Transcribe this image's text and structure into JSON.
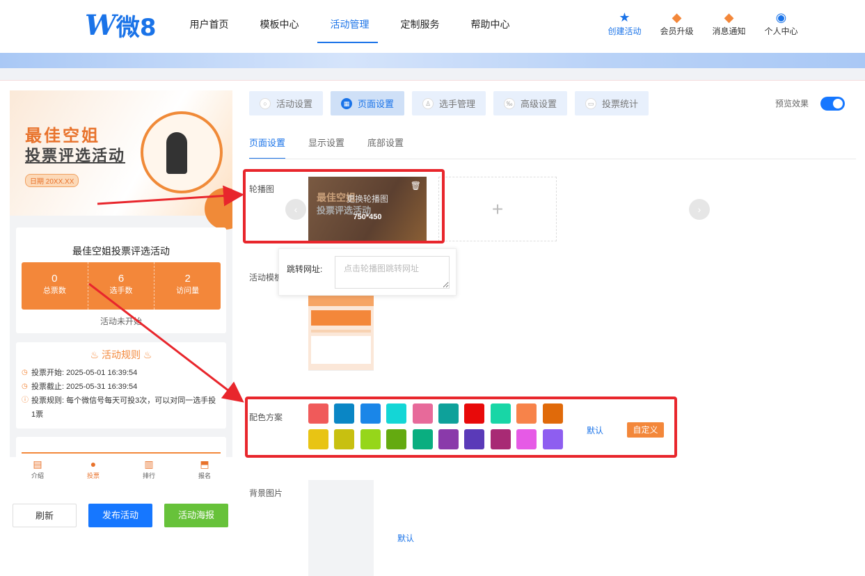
{
  "logo": {
    "mark": "W",
    "text": "微8"
  },
  "nav": [
    "用户首页",
    "模板中心",
    "活动管理",
    "定制服务",
    "帮助中心"
  ],
  "top_icons": [
    {
      "icon": "star-icon",
      "glyph": "★",
      "label": "创建活动"
    },
    {
      "icon": "diamond-icon",
      "glyph": "◆",
      "label": "会员升级"
    },
    {
      "icon": "bell-icon",
      "glyph": "◆",
      "label": "消息通知"
    },
    {
      "icon": "user-icon",
      "glyph": "◉",
      "label": "个人中心"
    }
  ],
  "poster": {
    "line1": "最佳空姐",
    "line2": "投票评选活动",
    "date": "日期 20XX.XX"
  },
  "activity": {
    "title": "最佳空姐投票评选活动",
    "stats": [
      {
        "value": "0",
        "label": "总票数"
      },
      {
        "value": "6",
        "label": "选手数"
      },
      {
        "value": "2",
        "label": "访问量"
      }
    ],
    "status": "活动未开始"
  },
  "rules": {
    "title": "活动规则",
    "items": [
      {
        "label": "投票开始:",
        "value": "2025-05-01 16:39:54"
      },
      {
        "label": "投票截止:",
        "value": "2025-05-31 16:39:54"
      },
      {
        "label": "投票规则:",
        "value": "每个微信号每天可投3次，可以对同一选手投1票"
      }
    ]
  },
  "bottom_tabs": [
    {
      "icon": "intro-icon",
      "glyph": "▤",
      "label": "介绍"
    },
    {
      "icon": "vote-icon",
      "glyph": "●",
      "label": "投票"
    },
    {
      "icon": "rank-icon",
      "glyph": "▥",
      "label": "排行"
    },
    {
      "icon": "signup-icon",
      "glyph": "⬒",
      "label": "报名"
    }
  ],
  "buttons": {
    "refresh": "刷新",
    "publish": "发布活动",
    "poster": "活动海报"
  },
  "tabs": [
    {
      "icon": "settings-icon",
      "label": "活动设置"
    },
    {
      "icon": "page-icon",
      "label": "页面设置"
    },
    {
      "icon": "player-icon",
      "label": "选手管理"
    },
    {
      "icon": "advanced-icon",
      "label": "高级设置"
    },
    {
      "icon": "stats-icon",
      "label": "投票统计"
    }
  ],
  "preview_label": "预览效果",
  "subtabs": [
    "页面设置",
    "显示设置",
    "底部设置"
  ],
  "carousel": {
    "label": "轮播图",
    "overlay": "更换轮播图",
    "size": "750*450",
    "link_label": "跳转网址:",
    "link_placeholder": "点击轮播图跳转网址"
  },
  "template_label": "活动模板",
  "color_scheme": {
    "label": "配色方案",
    "colors": [
      "#f05a5a",
      "#0a86c5",
      "#1a86e8",
      "#14d6d6",
      "#e76a9a",
      "#0ea19a",
      "#e80a0a",
      "#18d6a6",
      "#f7834a",
      "#e06a0a",
      "#e8c414",
      "#c8c010",
      "#96d61a",
      "#64aa10",
      "#0aae80",
      "#8a3aaa",
      "#5a3ab8",
      "#a82a74",
      "#e65ae6",
      "#8e5ef0"
    ],
    "default": "默认",
    "custom": "自定义"
  },
  "background": {
    "label": "背景图片",
    "default": "默认"
  }
}
